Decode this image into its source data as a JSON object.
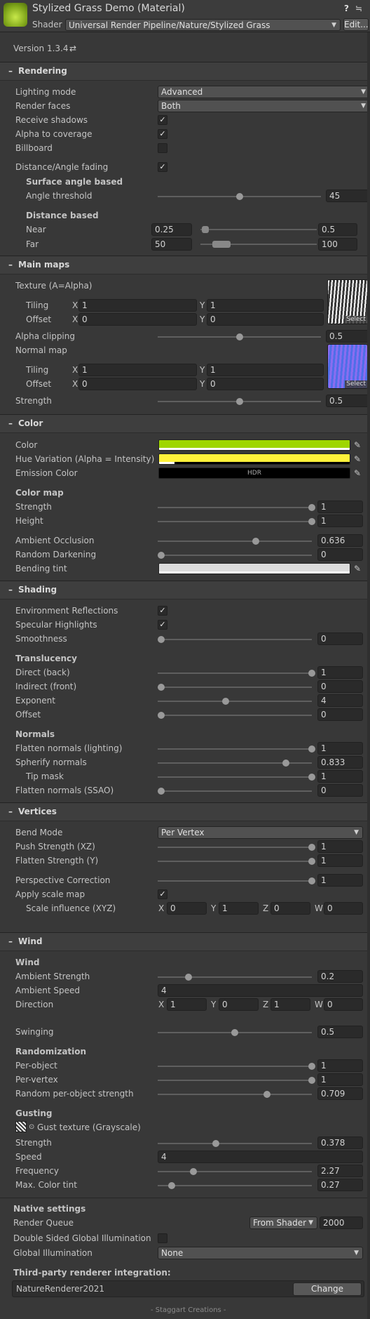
{
  "header": {
    "title": "Stylized Grass Demo (Material)",
    "shader_label": "Shader",
    "shader_value": "Universal Render Pipeline/Nature/Stylized Grass",
    "edit_label": "Edit...",
    "help_icon": "?",
    "settings_icon": "≒"
  },
  "version": {
    "label": "Version 1.3.4",
    "refresh_icon": "⇄"
  },
  "sections": {
    "rendering": "Rendering",
    "main_maps": "Main maps",
    "color": "Color",
    "shading": "Shading",
    "vertices": "Vertices",
    "wind": "Wind"
  },
  "rendering": {
    "lighting_mode_label": "Lighting mode",
    "lighting_mode_value": "Advanced",
    "render_faces_label": "Render faces",
    "render_faces_value": "Both",
    "receive_shadows_label": "Receive shadows",
    "receive_shadows": true,
    "alpha_to_coverage_label": "Alpha to coverage",
    "alpha_to_coverage": true,
    "billboard_label": "Billboard",
    "billboard": false,
    "distance_angle_fading_label": "Distance/Angle fading",
    "distance_angle_fading": true,
    "surface_angle_heading": "Surface angle based",
    "angle_threshold_label": "Angle threshold",
    "angle_threshold_value": "45",
    "angle_threshold_fraction": 0.5,
    "distance_heading": "Distance based",
    "near_label": "Near",
    "near_min": "0.25",
    "near_max": "0.5",
    "far_label": "Far",
    "far_min": "50",
    "far_max": "100"
  },
  "main_maps": {
    "texture_label": "Texture (A=Alpha)",
    "tiling_label": "Tiling",
    "offset_label": "Offset",
    "tex_tiling_x": "1",
    "tex_tiling_y": "1",
    "tex_offset_x": "0",
    "tex_offset_y": "0",
    "select_label": "Select",
    "alpha_clipping_label": "Alpha clipping",
    "alpha_clipping_value": "0.5",
    "alpha_clipping_fraction": 0.5,
    "normal_map_label": "Normal map",
    "nrm_tiling_x": "1",
    "nrm_tiling_y": "1",
    "nrm_offset_x": "0",
    "nrm_offset_y": "0",
    "strength_label": "Strength",
    "strength_value": "0.5",
    "strength_fraction": 0.5,
    "x": "X",
    "y": "Y"
  },
  "color": {
    "color_label": "Color",
    "color_hex": "#9fd600",
    "hue_variation_label": "Hue Variation (Alpha = Intensity)",
    "hue_hex": "#fff23a",
    "emission_label": "Emission Color",
    "hdr_label": "HDR",
    "color_map_heading": "Color map",
    "strength_label": "Strength",
    "strength_value": "1",
    "height_label": "Height",
    "height_value": "1",
    "ao_label": "Ambient Occlusion",
    "ao_value": "0.636",
    "random_darkening_label": "Random Darkening",
    "random_darkening_value": "0",
    "bending_tint_label": "Bending tint",
    "bending_hex": "#dcdcdc",
    "picker_icon": "✎"
  },
  "shading": {
    "env_reflections_label": "Environment Reflections",
    "env_reflections": true,
    "specular_label": "Specular Highlights",
    "specular": true,
    "smoothness_label": "Smoothness",
    "smoothness_value": "0",
    "translucency_heading": "Translucency",
    "direct_label": "Direct (back)",
    "direct_value": "1",
    "indirect_label": "Indirect (front)",
    "indirect_value": "0",
    "exponent_label": "Exponent",
    "exponent_value": "4",
    "offset_label": "Offset",
    "offset_value": "0",
    "normals_heading": "Normals",
    "flatten_lighting_label": "Flatten normals (lighting)",
    "flatten_lighting_value": "1",
    "spherify_label": "Spherify normals",
    "spherify_value": "0.833",
    "tip_mask_label": "Tip mask",
    "tip_mask_value": "1",
    "flatten_ssao_label": "Flatten normals (SSAO)",
    "flatten_ssao_value": "0"
  },
  "vertices": {
    "bend_mode_label": "Bend Mode",
    "bend_mode_value": "Per Vertex",
    "push_label": "Push Strength (XZ)",
    "push_value": "1",
    "flatten_label": "Flatten Strength (Y)",
    "flatten_value": "1",
    "perspective_label": "Perspective Correction",
    "perspective_value": "1",
    "apply_scale_label": "Apply scale map",
    "apply_scale": true,
    "scale_influence_label": "Scale influence (XYZ)",
    "sx": "0",
    "sy": "1",
    "sz": "0",
    "sw": "0"
  },
  "wind": {
    "wind_heading": "Wind",
    "ambient_strength_label": "Ambient Strength",
    "ambient_strength_value": "0.2",
    "ambient_speed_label": "Ambient Speed",
    "ambient_speed_value": "4",
    "direction_label": "Direction",
    "dx": "1",
    "dy": "0",
    "dz": "1",
    "dw": "0",
    "swinging_label": "Swinging",
    "swinging_value": "0.5",
    "randomization_heading": "Randomization",
    "per_object_label": "Per-object",
    "per_object_value": "1",
    "per_vertex_label": "Per-vertex",
    "per_vertex_value": "1",
    "random_strength_label": "Random per-object strength",
    "random_strength_value": "0.709",
    "gusting_heading": "Gusting",
    "gust_texture_label": "Gust texture (Grayscale)",
    "gust_strength_label": "Strength",
    "gust_strength_value": "0.378",
    "speed_label": "Speed",
    "speed_value": "4",
    "frequency_label": "Frequency",
    "frequency_value": "2.27",
    "max_tint_label": "Max. Color tint",
    "max_tint_value": "0.27",
    "x": "X",
    "y": "Y",
    "z": "Z",
    "w": "W"
  },
  "native": {
    "heading": "Native settings",
    "render_queue_label": "Render Queue",
    "render_queue_mode": "From Shader",
    "render_queue_value": "2000",
    "double_sided_gi_label": "Double Sided Global Illumination",
    "double_sided_gi": false,
    "gi_label": "Global Illumination",
    "gi_value": "None"
  },
  "third_party": {
    "heading": "Third-party renderer integration:",
    "value": "NatureRenderer2021",
    "change_label": "Change"
  },
  "footer": {
    "credit": "- Staggart Creations -"
  }
}
